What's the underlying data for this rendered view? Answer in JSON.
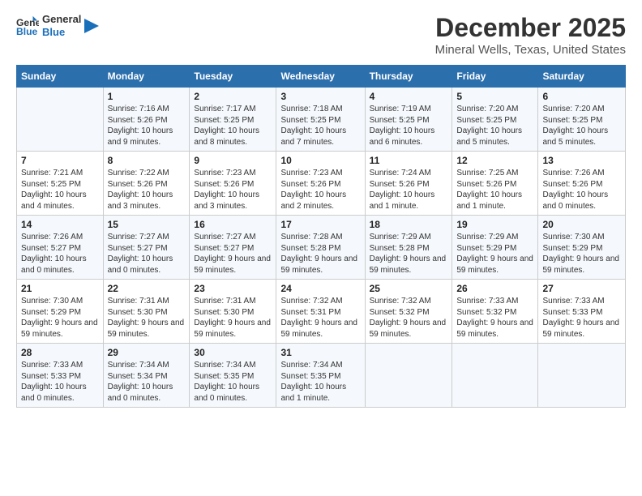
{
  "header": {
    "logo_line1": "General",
    "logo_line2": "Blue",
    "title": "December 2025",
    "subtitle": "Mineral Wells, Texas, United States"
  },
  "weekdays": [
    "Sunday",
    "Monday",
    "Tuesday",
    "Wednesday",
    "Thursday",
    "Friday",
    "Saturday"
  ],
  "weeks": [
    [
      {
        "day": "",
        "sunrise": "",
        "sunset": "",
        "daylight": ""
      },
      {
        "day": "1",
        "sunrise": "Sunrise: 7:16 AM",
        "sunset": "Sunset: 5:26 PM",
        "daylight": "Daylight: 10 hours and 9 minutes."
      },
      {
        "day": "2",
        "sunrise": "Sunrise: 7:17 AM",
        "sunset": "Sunset: 5:25 PM",
        "daylight": "Daylight: 10 hours and 8 minutes."
      },
      {
        "day": "3",
        "sunrise": "Sunrise: 7:18 AM",
        "sunset": "Sunset: 5:25 PM",
        "daylight": "Daylight: 10 hours and 7 minutes."
      },
      {
        "day": "4",
        "sunrise": "Sunrise: 7:19 AM",
        "sunset": "Sunset: 5:25 PM",
        "daylight": "Daylight: 10 hours and 6 minutes."
      },
      {
        "day": "5",
        "sunrise": "Sunrise: 7:20 AM",
        "sunset": "Sunset: 5:25 PM",
        "daylight": "Daylight: 10 hours and 5 minutes."
      },
      {
        "day": "6",
        "sunrise": "Sunrise: 7:20 AM",
        "sunset": "Sunset: 5:25 PM",
        "daylight": "Daylight: 10 hours and 5 minutes."
      }
    ],
    [
      {
        "day": "7",
        "sunrise": "Sunrise: 7:21 AM",
        "sunset": "Sunset: 5:25 PM",
        "daylight": "Daylight: 10 hours and 4 minutes."
      },
      {
        "day": "8",
        "sunrise": "Sunrise: 7:22 AM",
        "sunset": "Sunset: 5:26 PM",
        "daylight": "Daylight: 10 hours and 3 minutes."
      },
      {
        "day": "9",
        "sunrise": "Sunrise: 7:23 AM",
        "sunset": "Sunset: 5:26 PM",
        "daylight": "Daylight: 10 hours and 3 minutes."
      },
      {
        "day": "10",
        "sunrise": "Sunrise: 7:23 AM",
        "sunset": "Sunset: 5:26 PM",
        "daylight": "Daylight: 10 hours and 2 minutes."
      },
      {
        "day": "11",
        "sunrise": "Sunrise: 7:24 AM",
        "sunset": "Sunset: 5:26 PM",
        "daylight": "Daylight: 10 hours and 1 minute."
      },
      {
        "day": "12",
        "sunrise": "Sunrise: 7:25 AM",
        "sunset": "Sunset: 5:26 PM",
        "daylight": "Daylight: 10 hours and 1 minute."
      },
      {
        "day": "13",
        "sunrise": "Sunrise: 7:26 AM",
        "sunset": "Sunset: 5:26 PM",
        "daylight": "Daylight: 10 hours and 0 minutes."
      }
    ],
    [
      {
        "day": "14",
        "sunrise": "Sunrise: 7:26 AM",
        "sunset": "Sunset: 5:27 PM",
        "daylight": "Daylight: 10 hours and 0 minutes."
      },
      {
        "day": "15",
        "sunrise": "Sunrise: 7:27 AM",
        "sunset": "Sunset: 5:27 PM",
        "daylight": "Daylight: 10 hours and 0 minutes."
      },
      {
        "day": "16",
        "sunrise": "Sunrise: 7:27 AM",
        "sunset": "Sunset: 5:27 PM",
        "daylight": "Daylight: 9 hours and 59 minutes."
      },
      {
        "day": "17",
        "sunrise": "Sunrise: 7:28 AM",
        "sunset": "Sunset: 5:28 PM",
        "daylight": "Daylight: 9 hours and 59 minutes."
      },
      {
        "day": "18",
        "sunrise": "Sunrise: 7:29 AM",
        "sunset": "Sunset: 5:28 PM",
        "daylight": "Daylight: 9 hours and 59 minutes."
      },
      {
        "day": "19",
        "sunrise": "Sunrise: 7:29 AM",
        "sunset": "Sunset: 5:29 PM",
        "daylight": "Daylight: 9 hours and 59 minutes."
      },
      {
        "day": "20",
        "sunrise": "Sunrise: 7:30 AM",
        "sunset": "Sunset: 5:29 PM",
        "daylight": "Daylight: 9 hours and 59 minutes."
      }
    ],
    [
      {
        "day": "21",
        "sunrise": "Sunrise: 7:30 AM",
        "sunset": "Sunset: 5:29 PM",
        "daylight": "Daylight: 9 hours and 59 minutes."
      },
      {
        "day": "22",
        "sunrise": "Sunrise: 7:31 AM",
        "sunset": "Sunset: 5:30 PM",
        "daylight": "Daylight: 9 hours and 59 minutes."
      },
      {
        "day": "23",
        "sunrise": "Sunrise: 7:31 AM",
        "sunset": "Sunset: 5:30 PM",
        "daylight": "Daylight: 9 hours and 59 minutes."
      },
      {
        "day": "24",
        "sunrise": "Sunrise: 7:32 AM",
        "sunset": "Sunset: 5:31 PM",
        "daylight": "Daylight: 9 hours and 59 minutes."
      },
      {
        "day": "25",
        "sunrise": "Sunrise: 7:32 AM",
        "sunset": "Sunset: 5:32 PM",
        "daylight": "Daylight: 9 hours and 59 minutes."
      },
      {
        "day": "26",
        "sunrise": "Sunrise: 7:33 AM",
        "sunset": "Sunset: 5:32 PM",
        "daylight": "Daylight: 9 hours and 59 minutes."
      },
      {
        "day": "27",
        "sunrise": "Sunrise: 7:33 AM",
        "sunset": "Sunset: 5:33 PM",
        "daylight": "Daylight: 9 hours and 59 minutes."
      }
    ],
    [
      {
        "day": "28",
        "sunrise": "Sunrise: 7:33 AM",
        "sunset": "Sunset: 5:33 PM",
        "daylight": "Daylight: 10 hours and 0 minutes."
      },
      {
        "day": "29",
        "sunrise": "Sunrise: 7:34 AM",
        "sunset": "Sunset: 5:34 PM",
        "daylight": "Daylight: 10 hours and 0 minutes."
      },
      {
        "day": "30",
        "sunrise": "Sunrise: 7:34 AM",
        "sunset": "Sunset: 5:35 PM",
        "daylight": "Daylight: 10 hours and 0 minutes."
      },
      {
        "day": "31",
        "sunrise": "Sunrise: 7:34 AM",
        "sunset": "Sunset: 5:35 PM",
        "daylight": "Daylight: 10 hours and 1 minute."
      },
      {
        "day": "",
        "sunrise": "",
        "sunset": "",
        "daylight": ""
      },
      {
        "day": "",
        "sunrise": "",
        "sunset": "",
        "daylight": ""
      },
      {
        "day": "",
        "sunrise": "",
        "sunset": "",
        "daylight": ""
      }
    ]
  ]
}
